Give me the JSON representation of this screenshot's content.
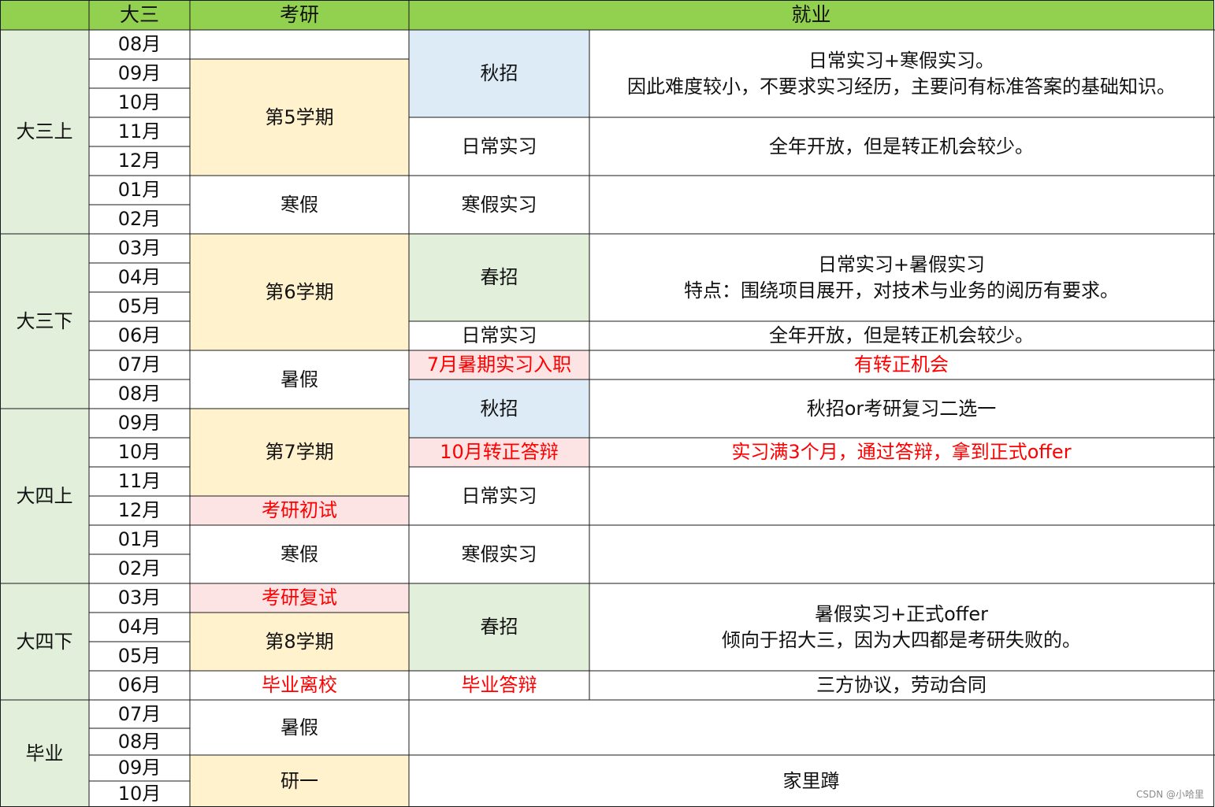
{
  "header": {
    "blank": "",
    "col_grade": "大三",
    "col_exam": "考研",
    "col_job": "就业"
  },
  "periods": [
    "大三上",
    "大三下",
    "大四上",
    "大四下",
    "毕业"
  ],
  "months": [
    "08月",
    "09月",
    "10月",
    "11月",
    "12月",
    "01月",
    "02月",
    "03月",
    "04月",
    "05月",
    "06月",
    "07月",
    "08月",
    "09月",
    "10月",
    "11月",
    "12月",
    "01月",
    "02月",
    "03月",
    "04月",
    "05月",
    "06月",
    "07月",
    "08月",
    "09月",
    "10月"
  ],
  "exam": {
    "sem5": "第5学期",
    "winter1": "寒假",
    "sem6": "第6学期",
    "summer1": "暑假",
    "sem7": "第7学期",
    "prelim": "考研初试",
    "winter2": "寒假",
    "retest": "考研复试",
    "sem8": "第8学期",
    "graduate_leave": "毕业离校",
    "summer2": "暑假",
    "grad1": "研一"
  },
  "job_type": {
    "autumn1": "秋招",
    "daily1": "日常实习",
    "winter_intern1": "寒假实习",
    "spring1": "春招",
    "daily2": "日常实习",
    "july_intern": "7月暑期实习入职",
    "autumn2": "秋招",
    "oct_defense": "10月转正答辩",
    "daily3": "日常实习",
    "winter_intern2": "寒假实习",
    "spring2": "春招",
    "grad_defense": "毕业答辩"
  },
  "job_desc": {
    "autumn1": "日常实习+寒假实习。\n因此难度较小，不要求实习经历，主要问有标准答案的基础知识。",
    "daily1": "全年开放，但是转正机会较少。",
    "spring1": "日常实习+暑假实习\n特点：围绕项目展开，对技术与业务的阅历有要求。",
    "daily2": "全年开放，但是转正机会较少。",
    "july_intern": "有转正机会",
    "autumn2": "秋招or考研复习二选一",
    "oct_defense": "实习满3个月，通过答辩，拿到正式offer",
    "spring2": "暑假实习+正式offer\n倾向于招大三，因为大四都是考研失败的。",
    "grad_defense": "三方协议，劳动合同",
    "home": "家里蹲"
  },
  "watermark": "CSDN @小哈里",
  "colors": {
    "header_green": "#92d050",
    "light_green": "#e2efda",
    "light_yellow": "#fff2cc",
    "light_blue": "#ddebf7",
    "light_pink": "#fce4e4",
    "red_text": "#ff0000"
  }
}
